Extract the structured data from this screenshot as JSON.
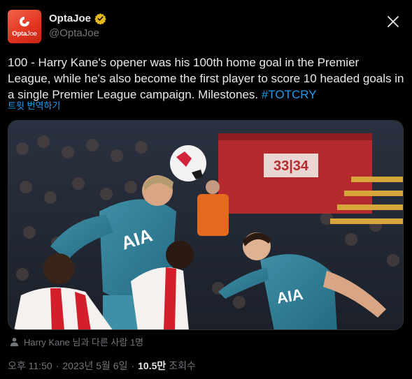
{
  "user": {
    "avatar_text_bold": "Opta",
    "avatar_text_light": "Joe",
    "display_name": "OptaJoe",
    "handle": "@OptaJoe",
    "verified_icon": "verified-badge-gold-icon"
  },
  "tweet": {
    "text_main": "100 - Harry Kane's opener was his 100th home goal in the Premier League, while he's also become the first player to score 10 headed goals in a single Premier League campaign. Milestones.",
    "hashtag": "#TOTCRY",
    "translate_label": "트윗 번역하기"
  },
  "media": {
    "stand_sign": "33|34",
    "shirt_sponsor_left": "AIA",
    "shirt_sponsor_right": "AIA"
  },
  "tagged": {
    "icon": "person-icon",
    "text": "Harry Kane 님과 다른 사람 1명"
  },
  "meta": {
    "time": "오후 11:50",
    "separator": "·",
    "date": "2023년 5월 6일",
    "views_count": "10.5만",
    "views_label": "조회수"
  },
  "colors": {
    "background": "#000000",
    "text": "#e7e9ea",
    "muted": "#71767b",
    "accent": "#1d9bf0",
    "brand": "#e8432c",
    "verified": "#e2b719"
  }
}
